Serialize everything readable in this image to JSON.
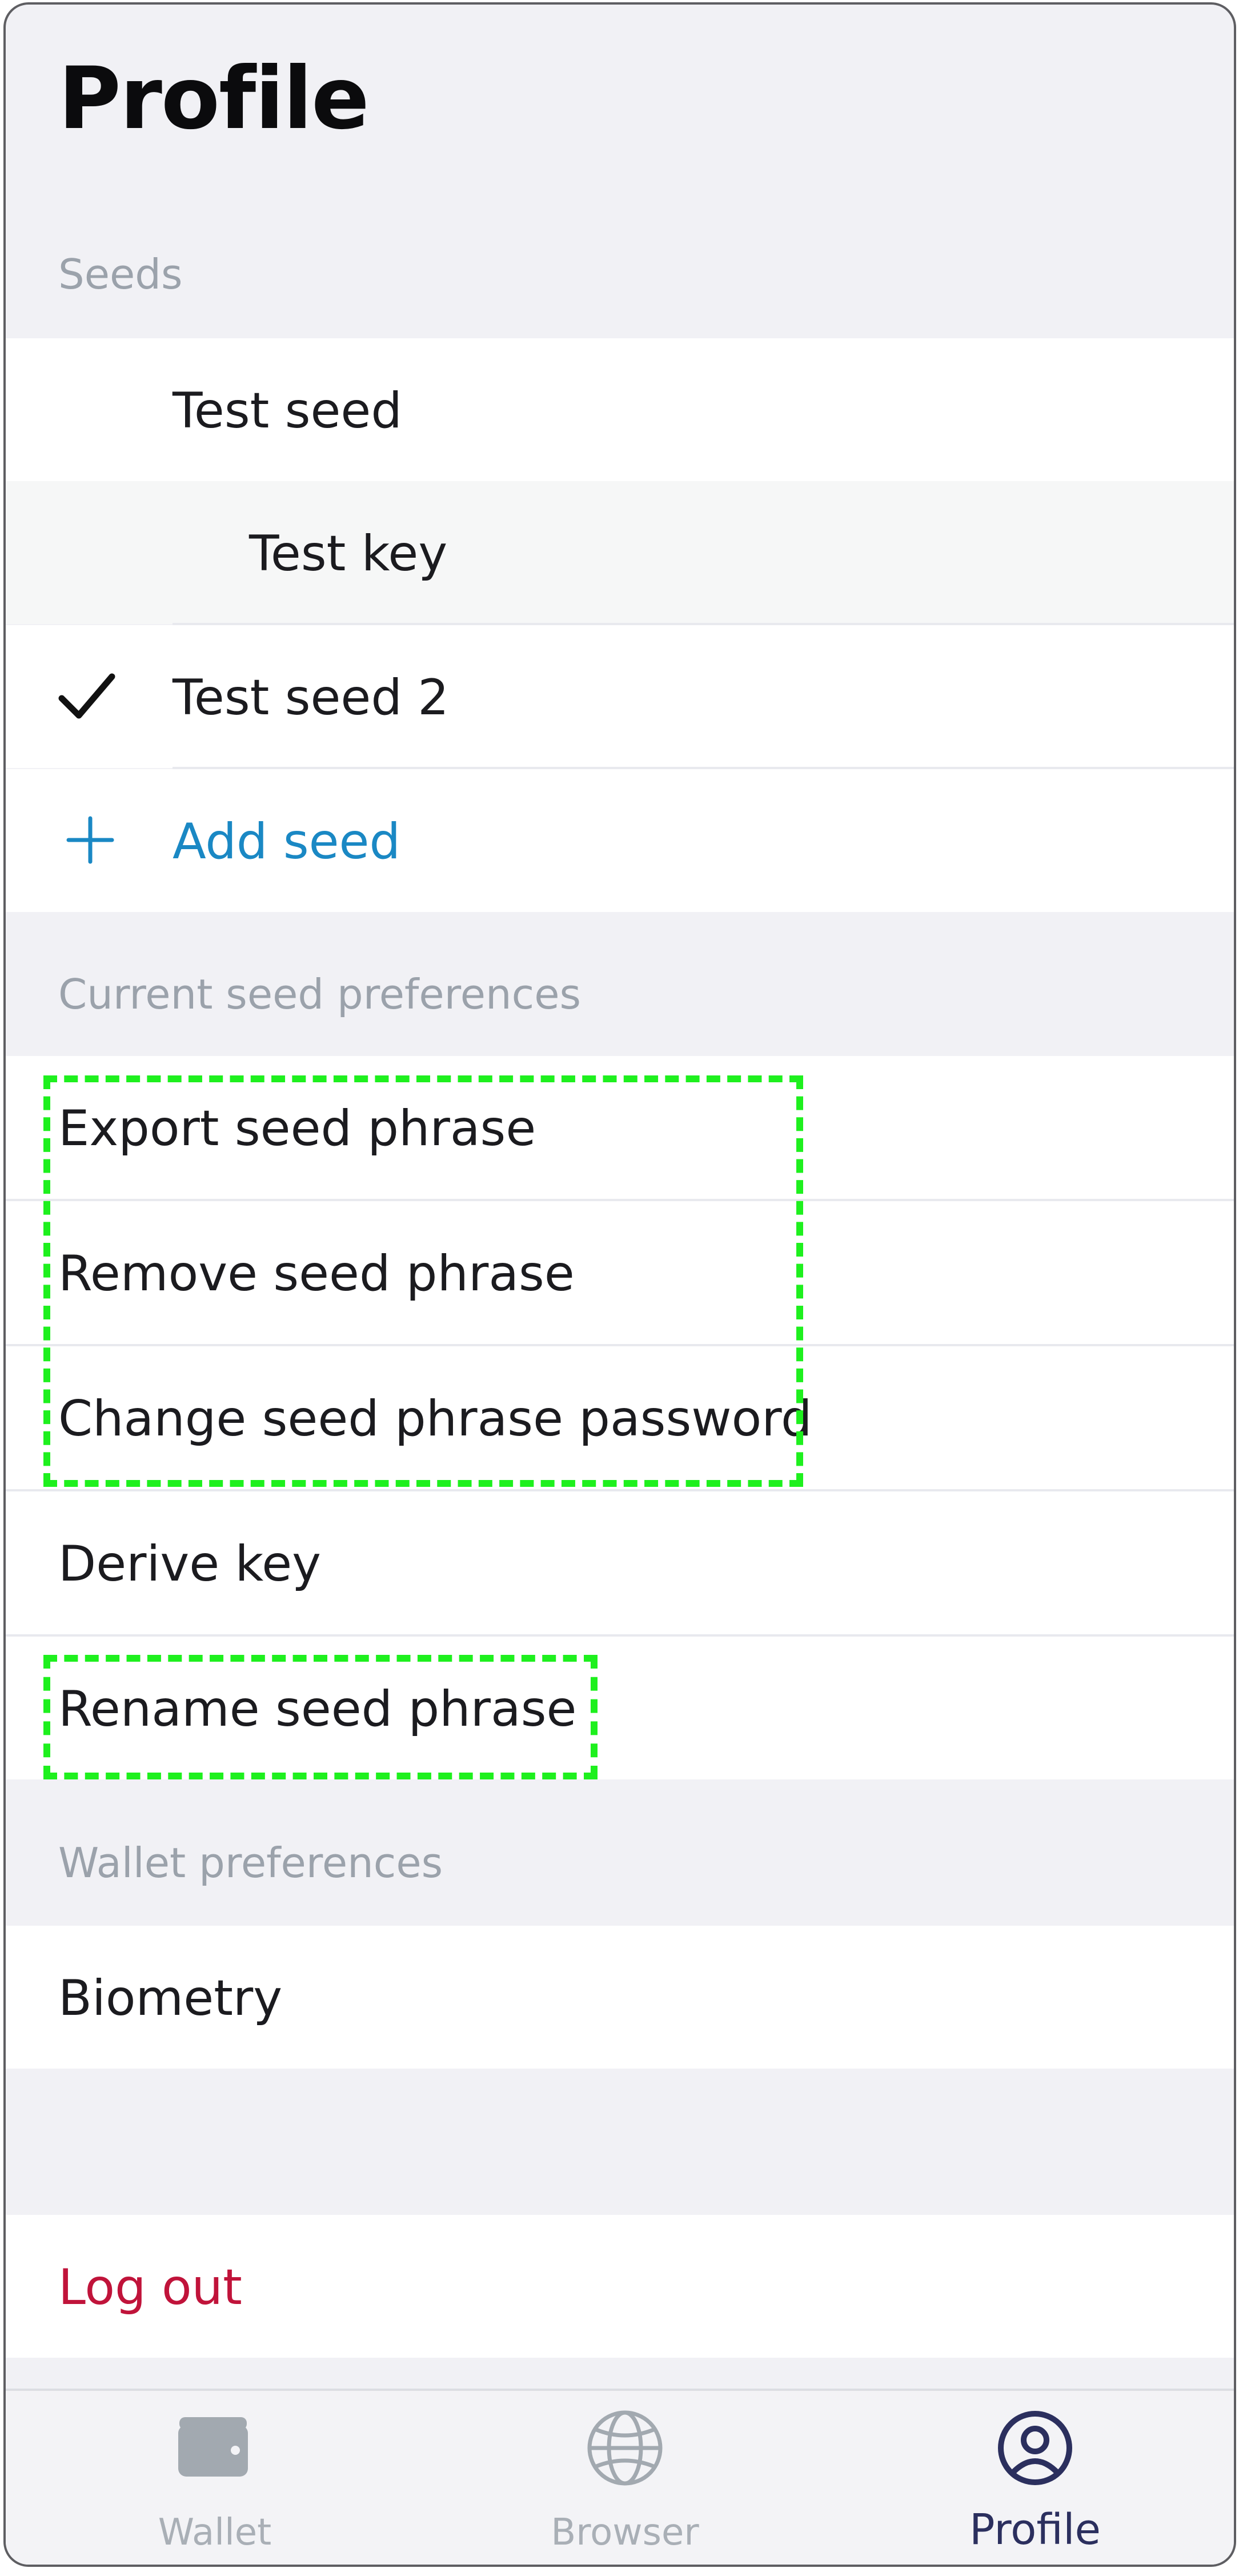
{
  "header": {
    "title": "Profile"
  },
  "seeds_section": {
    "header": "Seeds",
    "items": [
      {
        "label": "Test seed"
      },
      {
        "label": "Test key"
      },
      {
        "label": "Test seed 2",
        "icon": "checkmark-icon"
      },
      {
        "label": "Add seed",
        "icon": "plus-icon"
      }
    ]
  },
  "current_seed_section": {
    "header": "Current seed preferences",
    "items": [
      {
        "label": "Export seed phrase"
      },
      {
        "label": "Remove seed phrase"
      },
      {
        "label": "Change seed phrase password"
      },
      {
        "label": "Derive key"
      },
      {
        "label": "Rename seed phrase"
      }
    ]
  },
  "wallet_section": {
    "header": "Wallet preferences",
    "items": [
      {
        "label": "Biometry"
      }
    ]
  },
  "logout": {
    "label": "Log out"
  },
  "tabbar": {
    "tabs": [
      {
        "label": "Wallet",
        "icon": "wallet-icon",
        "active": false
      },
      {
        "label": "Browser",
        "icon": "globe-icon",
        "active": false
      },
      {
        "label": "Profile",
        "icon": "profile-icon",
        "active": true
      }
    ]
  },
  "colors": {
    "accent_blue": "#1a88c4",
    "danger_red": "#c0133a",
    "active_tab": "#2b2f5e",
    "inactive_tab": "#a9afb6",
    "highlight_green": "#1ef01e"
  }
}
